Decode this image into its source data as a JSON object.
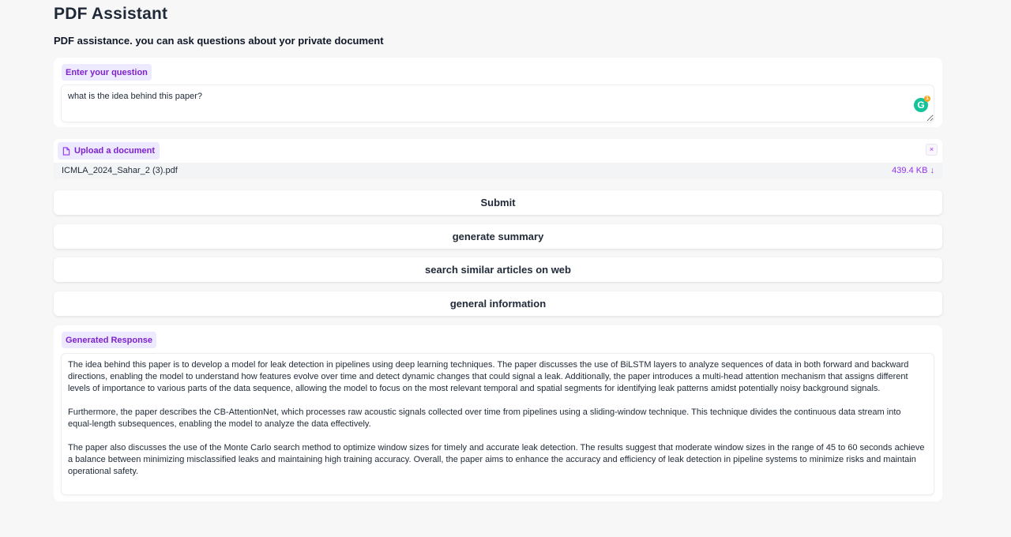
{
  "app": {
    "title": "PDF Assistant",
    "description": "PDF assistance. you can ask questions about yor private document"
  },
  "question": {
    "label": "Enter your question",
    "value": "what is the idea behind this paper?"
  },
  "upload": {
    "label": "Upload a document",
    "file_name": "ICMLA_2024_Sahar_2 (3).pdf",
    "file_size": "439.4 KB ↓",
    "close_icon": "×"
  },
  "buttons": {
    "submit": "Submit",
    "summary": "generate summary",
    "search": "search similar articles on web",
    "general": "general information"
  },
  "response": {
    "label": "Generated Response",
    "paragraphs": [
      "The idea behind this paper is to develop a model for leak detection in pipelines using deep learning techniques. The paper discusses the use of BiLSTM layers to analyze sequences of data in both forward and backward directions, enabling the model to understand how features evolve over time and detect dynamic changes that could signal a leak. Additionally, the paper introduces a multi-head attention mechanism that assigns different levels of importance to various parts of the data sequence, allowing the model to focus on the most relevant temporal and spatial segments for identifying leak patterns amidst potentially noisy background signals.",
      "Furthermore, the paper describes the CB-AttentionNet, which processes raw acoustic signals collected over time from pipelines using a sliding-window technique. This technique divides the continuous data stream into equal-length subsequences, enabling the model to analyze the data effectively.",
      "The paper also discusses the use of the Monte Carlo search method to optimize window sizes for timely and accurate leak detection. The results suggest that moderate window sizes in the range of 45 to 60 seconds achieve a balance between minimizing misclassified leaks and maintaining high training accuracy. Overall, the paper aims to enhance the accuracy and efficiency of leak detection in pipeline systems to minimize risks and maintain operational safety."
    ]
  },
  "colors": {
    "accent": "#9333ea",
    "tag_bg": "#ede9fe",
    "page_bg": "#f7f7f8"
  },
  "icons": {
    "document": "document-icon",
    "close": "close-icon",
    "grammarly": "grammarly-icon"
  }
}
